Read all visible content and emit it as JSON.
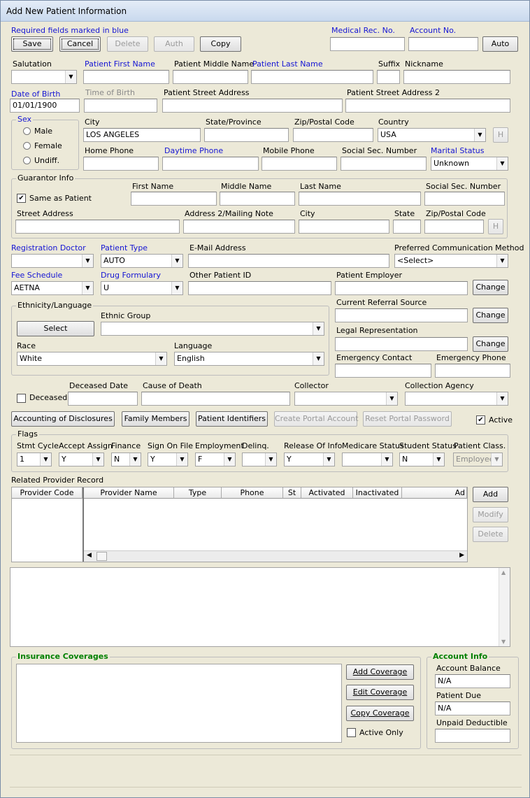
{
  "window": {
    "title": "Add New Patient Information"
  },
  "hint": "Required fields marked in blue",
  "toolbar": {
    "save": "Save",
    "cancel": "Cancel",
    "delete": "Delete",
    "auth": "Auth",
    "copy": "Copy",
    "auto": "Auto"
  },
  "ids": {
    "mrn_label": "Medical Rec. No.",
    "account_label": "Account No.",
    "mrn": "",
    "account": ""
  },
  "name": {
    "salutation_label": "Salutation",
    "first_label": "Patient First Name",
    "middle_label": "Patient Middle Name",
    "last_label": "Patient Last Name",
    "suffix_label": "Suffix",
    "nickname_label": "Nickname"
  },
  "birth": {
    "dob_label": "Date of Birth",
    "dob": "01/01/1900",
    "tob_label": "Time of Birth",
    "street_label": "Patient Street Address",
    "street2_label": "Patient Street Address 2"
  },
  "sex": {
    "label": "Sex",
    "options": [
      "Male",
      "Female",
      "Undiff."
    ]
  },
  "addr": {
    "city_label": "City",
    "city": "LOS ANGELES",
    "state_label": "State/Province",
    "zip_label": "Zip/Postal Code",
    "country_label": "Country",
    "country": "USA",
    "h": "H"
  },
  "phones": {
    "home_label": "Home Phone",
    "day_label": "Daytime Phone",
    "mobile_label": "Mobile Phone",
    "ssn_label": "Social Sec. Number",
    "marital_label": "Marital Status",
    "marital": "Unknown"
  },
  "guarantor": {
    "label": "Guarantor Info",
    "same": "Same as Patient",
    "first": "First Name",
    "middle": "Middle Name",
    "last": "Last Name",
    "ssn": "Social Sec. Number",
    "street": "Street Address",
    "addr2": "Address 2/Mailing Note",
    "city": "City",
    "state": "State",
    "zip": "Zip/Postal Code",
    "h": "H"
  },
  "reg": {
    "doctor_label": "Registration Doctor",
    "type_label": "Patient Type",
    "type": "AUTO",
    "email_label": "E-Mail Address",
    "comm_label": "Preferred Communication Method",
    "comm": "<Select>"
  },
  "fee": {
    "fee_label": "Fee Schedule",
    "fee": "AETNA",
    "drug_label": "Drug Formulary",
    "drug": "U",
    "other_label": "Other Patient ID",
    "employer_label": "Patient Employer",
    "change": "Change"
  },
  "ethnic": {
    "label": "Ethnicity/Language",
    "select": "Select",
    "group_label": "Ethnic Group",
    "race_label": "Race",
    "race": "White",
    "lang_label": "Language",
    "lang": "English"
  },
  "referral": {
    "label": "Current Referral Source",
    "legal_label": "Legal Representation",
    "emerg_label": "Emergency Contact",
    "emerg_phone_label": "Emergency Phone",
    "change": "Change"
  },
  "death": {
    "deceased": "Deceased",
    "date_label": "Deceased Date",
    "cause_label": "Cause of Death",
    "collector_label": "Collector",
    "agency_label": "Collection Agency"
  },
  "actions": {
    "disclosures": "Accounting of Disclosures",
    "family": "Family Members",
    "identifiers": "Patient Identifiers",
    "portal": "Create Portal Account",
    "reset": "Reset Portal Password",
    "active": "Active"
  },
  "flags": {
    "label": "Flags",
    "items": [
      {
        "label": "Stmt Cycle",
        "value": "1"
      },
      {
        "label": "Accept Assign",
        "value": "Y"
      },
      {
        "label": "Finance",
        "value": "N"
      },
      {
        "label": "Sign On File",
        "value": "Y"
      },
      {
        "label": "Employment",
        "value": "F"
      },
      {
        "label": "Delinq.",
        "value": ""
      },
      {
        "label": "Release Of Info",
        "value": "Y"
      },
      {
        "label": "Medicare Status",
        "value": ""
      },
      {
        "label": "Student Status",
        "value": "N"
      },
      {
        "label": "Patient Class.",
        "value": "Employee"
      }
    ]
  },
  "provider": {
    "label": "Related Provider Record",
    "col_code": "Provider Code",
    "cols": [
      "Provider Name",
      "Type",
      "Phone",
      "St",
      "Activated",
      "Inactivated",
      "Ad"
    ],
    "add": "Add",
    "modify": "Modify",
    "delete": "Delete"
  },
  "insurance": {
    "label": "Insurance Coverages",
    "add": "Add Coverage",
    "edit": "Edit Coverage",
    "copy": "Copy Coverage",
    "active_only": "Active Only"
  },
  "account": {
    "label": "Account Info",
    "balance_label": "Account Balance",
    "balance": "N/A",
    "due_label": "Patient Due",
    "due": "N/A",
    "deductible_label": "Unpaid Deductible"
  },
  "colors": {
    "required": "#1515d4",
    "section": "#008000"
  }
}
